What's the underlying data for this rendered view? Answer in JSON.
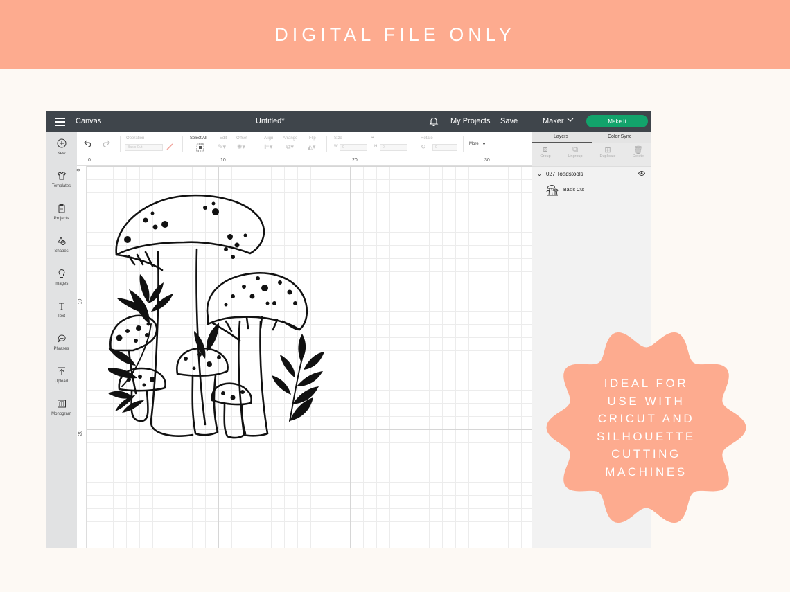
{
  "banner": {
    "text": "DIGITAL FILE ONLY"
  },
  "app": {
    "titlebar": {
      "canvas_label": "Canvas",
      "doc_title": "Untitled*",
      "my_projects": "My Projects",
      "save": "Save",
      "separator": "|",
      "machine": "Maker",
      "make_it": "Make It"
    },
    "toolbar": {
      "operation_label": "Operation",
      "operation_value": "Basic Cut",
      "select_all": "Select All",
      "edit": "Edit",
      "offset": "Offset",
      "align": "Align",
      "arrange": "Arrange",
      "flip": "Flip",
      "size": "Size",
      "w_label": "W",
      "w_value": "0",
      "h_label": "H",
      "h_value": "0",
      "rotate": "Rotate",
      "rotate_value": "0",
      "more": "More"
    },
    "sidebar": {
      "items": [
        {
          "label": "New",
          "icon": "plus-circle-icon"
        },
        {
          "label": "Templates",
          "icon": "tshirt-icon"
        },
        {
          "label": "Projects",
          "icon": "clipboard-icon"
        },
        {
          "label": "Shapes",
          "icon": "shapes-icon"
        },
        {
          "label": "Images",
          "icon": "lightbulb-icon"
        },
        {
          "label": "Text",
          "icon": "text-icon"
        },
        {
          "label": "Phrases",
          "icon": "speech-bubble-icon"
        },
        {
          "label": "Upload",
          "icon": "upload-icon"
        },
        {
          "label": "Monogram",
          "icon": "monogram-icon"
        }
      ]
    },
    "ruler": {
      "top": [
        "0",
        "10",
        "20",
        "30"
      ],
      "left": [
        "0",
        "10",
        "20"
      ]
    },
    "panel": {
      "tab_layers": "Layers",
      "tab_color_sync": "Color Sync",
      "actions": [
        "Group",
        "Ungroup",
        "Duplicate",
        "Delete"
      ],
      "group_name": "027 Toadstools",
      "layer_label": "Basic Cut"
    }
  },
  "badge": {
    "lines": [
      "IDEAL FOR",
      "USE WITH",
      "CRICUT AND",
      "SILHOUETTE",
      "CUTTING",
      "MACHINES"
    ],
    "color": "#fdab8f"
  },
  "colors": {
    "banner": "#fdab8f",
    "titlebar": "#3f454b",
    "make_it": "#12a36b",
    "background": "#fdf9f4"
  }
}
